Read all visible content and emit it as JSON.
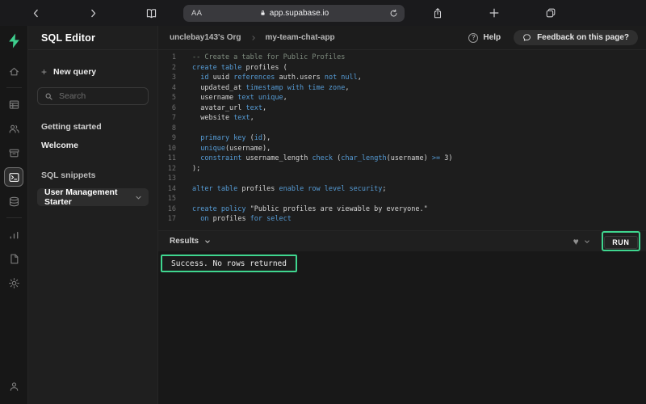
{
  "browser": {
    "text_size_label": "AA",
    "url": "app.supabase.io"
  },
  "sidebar": {
    "title": "SQL Editor",
    "new_query_label": "New query",
    "search_placeholder": "Search",
    "getting_started_label": "Getting started",
    "welcome_label": "Welcome",
    "snippets_label": "SQL snippets",
    "selected_snippet": "User Management Starter"
  },
  "header": {
    "breadcrumb": [
      "unclebay143's Org",
      "my-team-chat-app"
    ],
    "help_label": "Help",
    "feedback_label": "Feedback on this page?"
  },
  "editor": {
    "lines": [
      {
        "n": "1",
        "t": [
          [
            "c",
            "-- Create a table for Public Profiles"
          ]
        ]
      },
      {
        "n": "2",
        "t": [
          [
            "k",
            "create table"
          ],
          [
            "t",
            " profiles ("
          ]
        ]
      },
      {
        "n": "3",
        "t": [
          [
            "t",
            "  "
          ],
          [
            "k",
            "id"
          ],
          [
            "t",
            " uuid "
          ],
          [
            "k",
            "references"
          ],
          [
            "t",
            " auth.users "
          ],
          [
            "k",
            "not null"
          ],
          [
            "t",
            ","
          ]
        ]
      },
      {
        "n": "4",
        "t": [
          [
            "t",
            "  updated_at "
          ],
          [
            "k",
            "timestamp with time zone"
          ],
          [
            "t",
            ","
          ]
        ]
      },
      {
        "n": "5",
        "t": [
          [
            "t",
            "  username "
          ],
          [
            "k",
            "text unique"
          ],
          [
            "t",
            ","
          ]
        ]
      },
      {
        "n": "6",
        "t": [
          [
            "t",
            "  avatar_url "
          ],
          [
            "k",
            "text"
          ],
          [
            "t",
            ","
          ]
        ]
      },
      {
        "n": "7",
        "t": [
          [
            "t",
            "  website "
          ],
          [
            "k",
            "text"
          ],
          [
            "t",
            ","
          ]
        ]
      },
      {
        "n": "8",
        "t": []
      },
      {
        "n": "9",
        "t": [
          [
            "t",
            "  "
          ],
          [
            "k",
            "primary key"
          ],
          [
            "t",
            " ("
          ],
          [
            "k",
            "id"
          ],
          [
            "t",
            "),"
          ]
        ]
      },
      {
        "n": "10",
        "t": [
          [
            "t",
            "  "
          ],
          [
            "k",
            "unique"
          ],
          [
            "t",
            "(username),"
          ]
        ]
      },
      {
        "n": "11",
        "t": [
          [
            "t",
            "  "
          ],
          [
            "k",
            "constraint"
          ],
          [
            "t",
            " username_length "
          ],
          [
            "k",
            "check"
          ],
          [
            "t",
            " ("
          ],
          [
            "k",
            "char_length"
          ],
          [
            "t",
            "(username) "
          ],
          [
            "k",
            ">="
          ],
          [
            "t",
            " 3)"
          ]
        ]
      },
      {
        "n": "12",
        "t": [
          [
            "t",
            ");"
          ]
        ]
      },
      {
        "n": "13",
        "t": []
      },
      {
        "n": "14",
        "t": [
          [
            "k",
            "alter table"
          ],
          [
            "t",
            " profiles "
          ],
          [
            "k",
            "enable row level security"
          ],
          [
            "t",
            ";"
          ]
        ]
      },
      {
        "n": "15",
        "t": []
      },
      {
        "n": "16",
        "t": [
          [
            "k",
            "create policy"
          ],
          [
            "t",
            " \"Public profiles are viewable by everyone.\""
          ]
        ]
      },
      {
        "n": "17",
        "t": [
          [
            "t",
            "  "
          ],
          [
            "k",
            "on"
          ],
          [
            "t",
            " profiles "
          ],
          [
            "k",
            "for select"
          ]
        ]
      }
    ]
  },
  "results": {
    "label": "Results",
    "run_label": "RUN",
    "message": "Success. No rows returned"
  },
  "colors": {
    "accent": "#3ecf8e",
    "annotation": "#3fd68f",
    "keyword": "#569cd6",
    "comment": "#7f8c7f"
  }
}
